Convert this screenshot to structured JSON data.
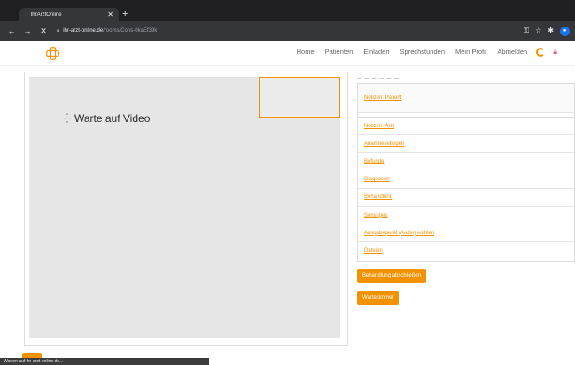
{
  "browser": {
    "tab_title": "IhrArztOnline",
    "url_domain": "ihr-arzt-online.de",
    "url_path": "/rooms/Cons-0kaEf39k",
    "status_text": "Warten auf ihr-arzt-online.de..."
  },
  "nav": {
    "items": [
      "Home",
      "Patienten",
      "Einladen",
      "Sprechstunden",
      "Mein Profil",
      "Abmelden"
    ]
  },
  "video": {
    "waiting_text": "Warte auf Video"
  },
  "sidebar": {
    "header": "— — — — — —",
    "sections": [
      "Notizen: Patient",
      "Notizen: Arzt",
      "Anamnesebogen",
      "Befunde",
      "Diagnosen",
      "Behandlung",
      "Sonstiges",
      "Ausgabegerät (Audio) wählen",
      "Dateien"
    ],
    "finish_button": "Behandlung abschließen",
    "waiting_room_button": "Wartezimmer"
  },
  "colors": {
    "accent": "#f39200",
    "chrome_dark": "#35363a"
  }
}
